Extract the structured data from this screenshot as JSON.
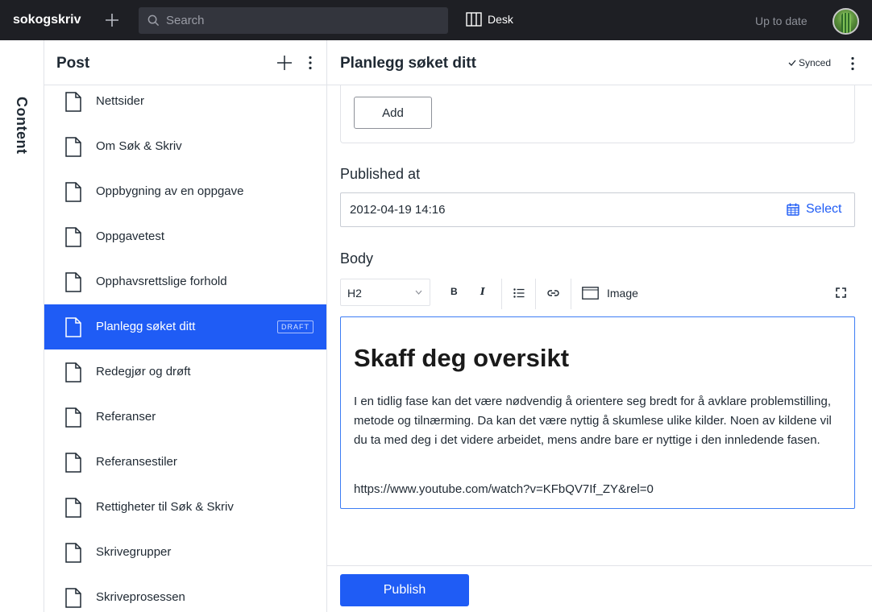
{
  "topbar": {
    "brand": "sokogskriv",
    "search_placeholder": "Search",
    "desk_label": "Desk",
    "status": "Up to date"
  },
  "sidebar_tab": {
    "label": "Content"
  },
  "list": {
    "title": "Post",
    "items": [
      {
        "label": "Nettsider"
      },
      {
        "label": "Om Søk & Skriv"
      },
      {
        "label": "Oppbygning av en oppgave"
      },
      {
        "label": "Oppgavetest"
      },
      {
        "label": "Opphavsrettslige forhold"
      },
      {
        "label": "Planlegg søket ditt",
        "badge": "DRAFT",
        "active": true
      },
      {
        "label": "Redegjør og drøft"
      },
      {
        "label": "Referanser"
      },
      {
        "label": "Referansestiler"
      },
      {
        "label": "Rettigheter til Søk & Skriv"
      },
      {
        "label": "Skrivegrupper"
      },
      {
        "label": "Skriveprosessen"
      }
    ]
  },
  "editor": {
    "title": "Planlegg søket ditt",
    "sync_status": "Synced",
    "add_label": "Add",
    "published_at": {
      "label": "Published at",
      "value": "2012-04-19 14:16",
      "select_label": "Select"
    },
    "body": {
      "label": "Body",
      "style_select": "H2",
      "bold": "B",
      "italic": "I",
      "image_label": "Image",
      "heading": "Skaff deg oversikt",
      "paragraph": "I en tidlig fase kan det være nødvendig å orientere seg bredt for å avklare problemstilling, metode og tilnærming. Da kan det være nyttig å skumlese ulike kilder. Noen av kildene vil du ta med deg i det videre arbeidet, mens andre bare er nyttige i den innledende fasen.",
      "url": "https://www.youtube.com/watch?v=KFbQV7If_ZY&rel=0"
    },
    "publish_label": "Publish"
  },
  "colors": {
    "accent": "#1f5cf5",
    "topbar": "#1e1f24"
  }
}
